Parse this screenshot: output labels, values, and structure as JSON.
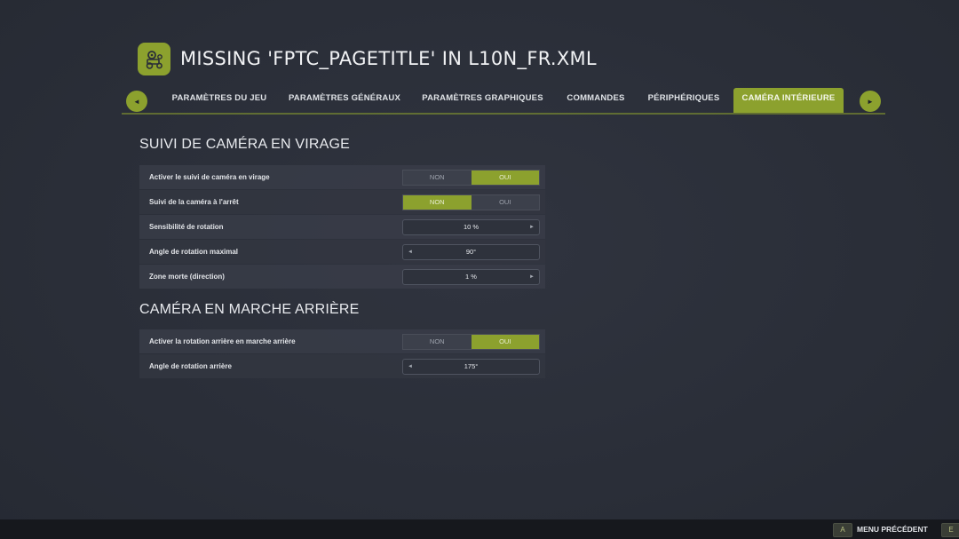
{
  "header": {
    "title": "MISSING 'FPTC_PAGETITLE' IN L10N_FR.XML",
    "icon": "tractor-settings-icon"
  },
  "tabs": [
    {
      "label": "PARAMÈTRES DU JEU",
      "active": false
    },
    {
      "label": "PARAMÈTRES GÉNÉRAUX",
      "active": false
    },
    {
      "label": "PARAMÈTRES GRAPHIQUES",
      "active": false
    },
    {
      "label": "COMMANDES",
      "active": false
    },
    {
      "label": "PÉRIPHÉRIQUES",
      "active": false
    },
    {
      "label": "CAMÉRA INTÉRIEURE",
      "active": true
    }
  ],
  "nav": {
    "prev": "◄",
    "next": "►"
  },
  "colors": {
    "accent": "#8ca12e",
    "background": "#2a2e38"
  },
  "sections": [
    {
      "title": "SUIVI DE CAMÉRA EN VIRAGE",
      "rows": [
        {
          "label": "Activer le suivi de caméra en virage",
          "type": "toggle",
          "options": [
            "NON",
            "OUI"
          ],
          "selected": "OUI"
        },
        {
          "label": "Suivi de la caméra à l'arrêt",
          "type": "toggle",
          "options": [
            "NON",
            "OUI"
          ],
          "selected": "NON"
        },
        {
          "label": "Sensibilité de rotation",
          "type": "stepper",
          "value": "10 %",
          "left": "",
          "right": "►"
        },
        {
          "label": "Angle de rotation maximal",
          "type": "stepper",
          "value": "90°",
          "left": "◄",
          "right": ""
        },
        {
          "label": "Zone morte (direction)",
          "type": "stepper",
          "value": "1 %",
          "left": "",
          "right": "►"
        }
      ]
    },
    {
      "title": "CAMÉRA EN MARCHE ARRIÈRE",
      "rows": [
        {
          "label": "Activer la rotation arrière en marche arrière",
          "type": "toggle",
          "options": [
            "NON",
            "OUI"
          ],
          "selected": "OUI"
        },
        {
          "label": "Angle de rotation arrière",
          "type": "stepper",
          "value": "175°",
          "left": "◄",
          "right": ""
        }
      ]
    }
  ],
  "footer": {
    "back_key": "A",
    "back_label": "MENU PRÉCÉDENT",
    "extra_key": "E"
  }
}
